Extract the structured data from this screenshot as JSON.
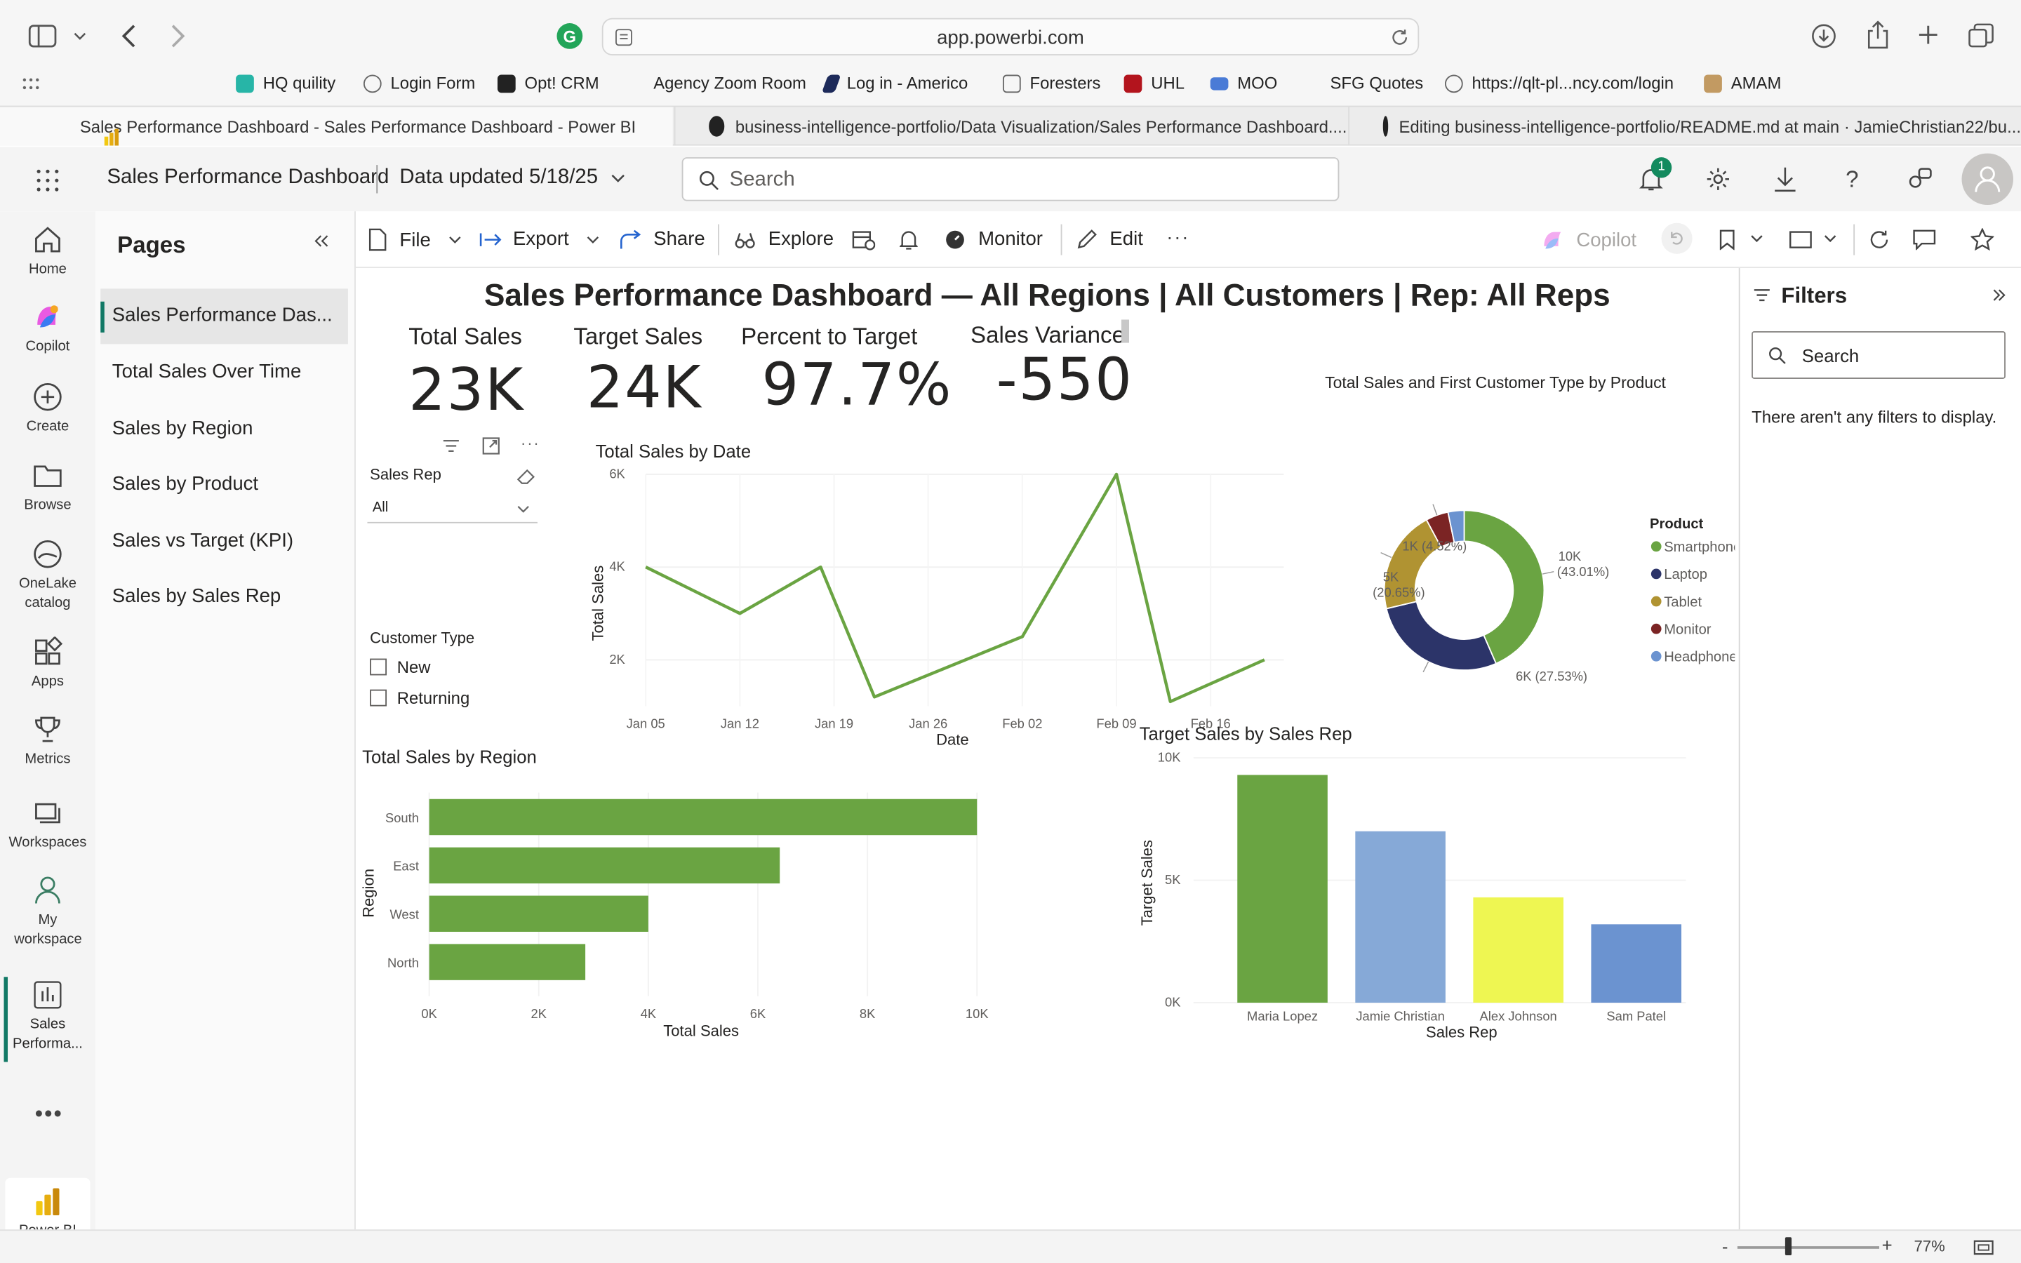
{
  "browser": {
    "address": "app.powerbi.com",
    "bookmarks": [
      "HQ quility",
      "Login Form",
      "Opt! CRM",
      "Agency Zoom Room",
      "Log in - Americo",
      "Foresters",
      "UHL",
      "MOO",
      "SFG Quotes",
      "https://qlt-pl...ncy.com/login",
      "AMAM"
    ],
    "tabs": [
      "Sales Performance Dashboard - Sales Performance Dashboard - Power BI",
      "business-intelligence-portfolio/Data Visualization/Sales Performance Dashboard....",
      "Editing business-intelligence-portfolio/README.md at main · JamieChristian22/bu..."
    ]
  },
  "header": {
    "report_name": "Sales Performance Dashboard",
    "data_updated": "Data updated 5/18/25",
    "search_placeholder": "Search",
    "notification_count": "1"
  },
  "rail": [
    "Home",
    "Copilot",
    "Create",
    "Browse",
    "OneLake catalog",
    "Apps",
    "Metrics",
    "Workspaces",
    "My workspace",
    "Sales Performa...",
    "Power BI"
  ],
  "pages_pane": {
    "title": "Pages",
    "items": [
      "Sales Performance Das...",
      "Total Sales Over Time",
      "Sales by Region",
      "Sales by Product",
      "Sales vs Target (KPI)",
      "Sales by Sales Rep"
    ]
  },
  "toolbar": {
    "file": "File",
    "export": "Export",
    "share": "Share",
    "explore": "Explore",
    "monitor": "Monitor",
    "edit": "Edit",
    "copilot": "Copilot"
  },
  "report": {
    "title": "Sales Performance Dashboard — All Regions | All Customers | Rep: All Reps",
    "kpis": [
      {
        "label": "Total Sales",
        "value": "23K"
      },
      {
        "label": "Target Sales",
        "value": "24K"
      },
      {
        "label": "Percent to Target",
        "value": "97.7%"
      },
      {
        "label": "Sales Variance",
        "value": "-550"
      }
    ],
    "slicer_rep": {
      "label": "Sales Rep",
      "value": "All"
    },
    "slicer_customer": {
      "label": "Customer Type",
      "options": [
        "New",
        "Returning"
      ]
    }
  },
  "chart_data": [
    {
      "type": "line",
      "title": "Total Sales by Date",
      "xlabel": "Date",
      "ylabel": "Total Sales",
      "x_ticks": [
        "Jan 05",
        "Jan 12",
        "Jan 19",
        "Jan 26",
        "Feb 02",
        "Feb 09",
        "Feb 16"
      ],
      "y_ticks": [
        "2K",
        "4K",
        "6K"
      ],
      "ylim": [
        1000,
        6000
      ],
      "series": [
        {
          "values": [
            {
              "x": "2025-01-05",
              "y": 4000
            },
            {
              "x": "2025-01-12",
              "y": 3000
            },
            {
              "x": "2025-01-18",
              "y": 4000
            },
            {
              "x": "2025-01-22",
              "y": 1200
            },
            {
              "x": "2025-02-02",
              "y": 2500
            },
            {
              "x": "2025-02-09",
              "y": 6000
            },
            {
              "x": "2025-02-13",
              "y": 1100
            },
            {
              "x": "2025-02-20",
              "y": 2000
            }
          ]
        }
      ],
      "color": "#6aa442"
    },
    {
      "type": "pie",
      "title": "Total Sales and First Customer Type by Product",
      "legend_title": "Product",
      "legend_position": "right",
      "slices": [
        {
          "name": "Smartphone",
          "value": 10000,
          "label": "10K (43.01%)",
          "color": "#6aa442"
        },
        {
          "name": "Laptop",
          "value": 6400,
          "label": "6K (27.53%)",
          "color": "#2c3469"
        },
        {
          "name": "Tablet",
          "value": 4800,
          "label": "5K (20.65%)",
          "color": "#b09332"
        },
        {
          "name": "Monitor",
          "value": 1050,
          "label": "1K (4.52%)",
          "color": "#7b2424"
        },
        {
          "name": "Headphones",
          "value": 750,
          "label": "",
          "color": "#6b93d0"
        }
      ]
    },
    {
      "type": "bar",
      "orientation": "horizontal",
      "title": "Total Sales by Region",
      "xlabel": "Total Sales",
      "ylabel": "Region",
      "categories": [
        "South",
        "East",
        "West",
        "North"
      ],
      "values": [
        10000,
        6400,
        4000,
        2850
      ],
      "x_ticks": [
        "0K",
        "2K",
        "4K",
        "6K",
        "8K",
        "10K"
      ],
      "xlim": [
        0,
        10000
      ],
      "color": "#6aa442"
    },
    {
      "type": "bar",
      "title": "Target Sales by Sales Rep",
      "xlabel": "Sales Rep",
      "ylabel": "Target Sales",
      "categories": [
        "Maria Lopez",
        "Jamie Christian",
        "Alex Johnson",
        "Sam Patel"
      ],
      "values": [
        9300,
        7000,
        4300,
        3200
      ],
      "y_ticks": [
        "0K",
        "5K",
        "10K"
      ],
      "ylim": [
        0,
        10000
      ],
      "colors": [
        "#6aa442",
        "#86a9d7",
        "#eef652",
        "#6b93d0"
      ]
    }
  ],
  "filters": {
    "title": "Filters",
    "search_placeholder": "Search",
    "empty_text": "There aren't any filters to display."
  },
  "status": {
    "zoom": "77%"
  }
}
